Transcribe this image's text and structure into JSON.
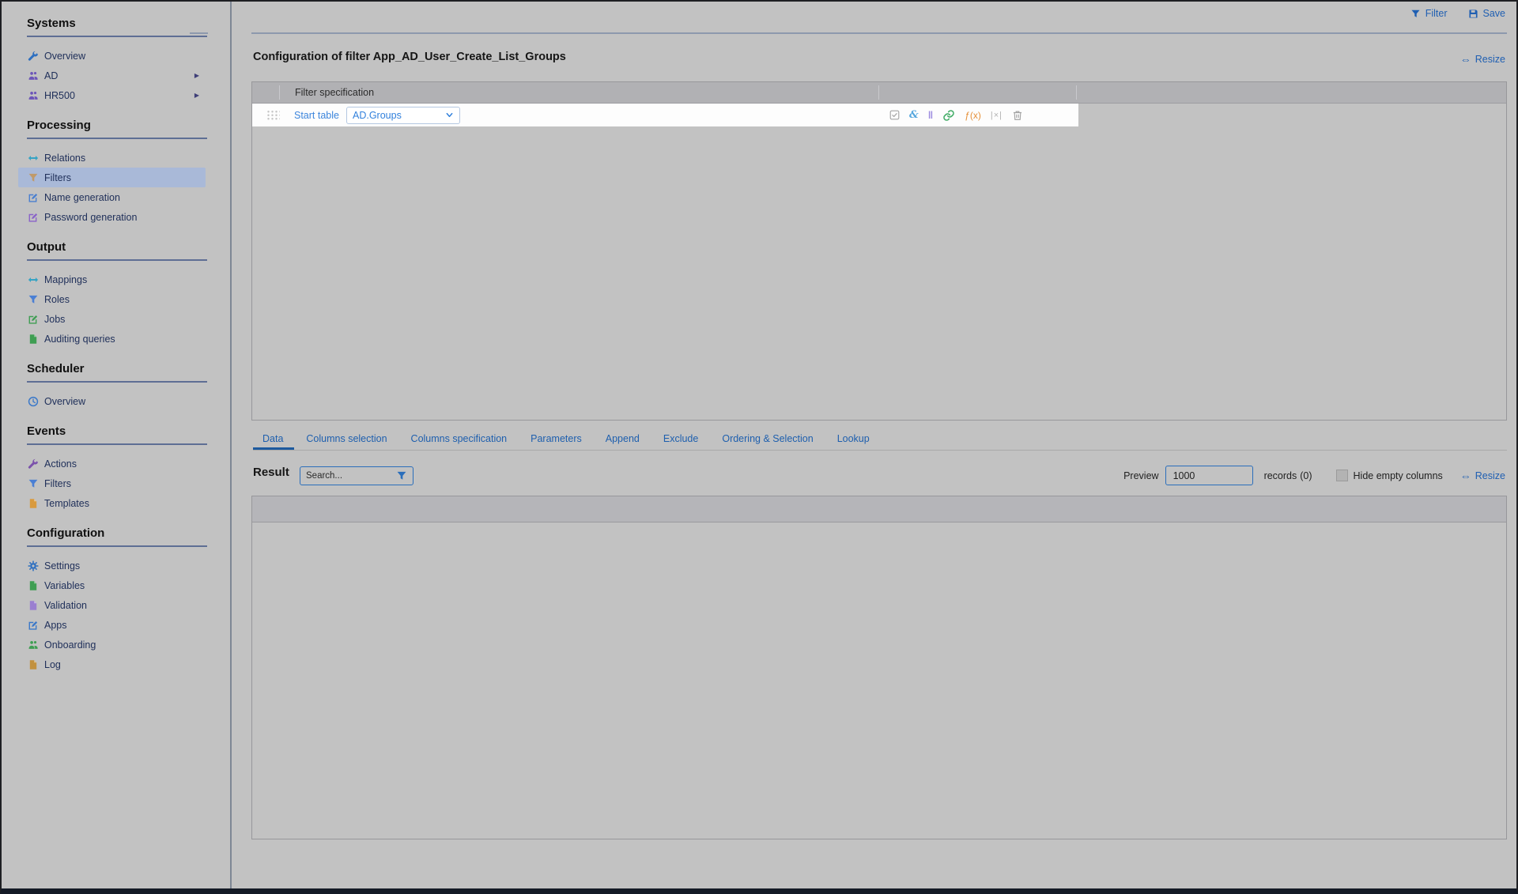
{
  "topbar": {
    "filter_label": "Filter",
    "save_label": "Save"
  },
  "page": {
    "title": "Configuration of filter App_AD_User_Create_List_Groups",
    "resize_label": "Resize"
  },
  "colors": {
    "accent_blue": "#1f5fb2",
    "link_blue": "#3c85dc",
    "selected_item_bg": "#a9b9d8",
    "page_bg": "#c2c2c2"
  },
  "filter_panel": {
    "header": "Filter specification",
    "start_table_label": "Start table",
    "start_table_value": "AD.Groups",
    "actions": [
      {
        "name": "validate-checkbox-icon",
        "glyph": "checksq",
        "color": "#a6a6a6"
      },
      {
        "name": "and-condition-icon",
        "glyph": "amp",
        "color": "#56a7de"
      },
      {
        "name": "or-condition-icon",
        "glyph": "pipes",
        "color": "#9d8ce0"
      },
      {
        "name": "link-table-icon",
        "glyph": "chain",
        "color": "#44ad68"
      },
      {
        "name": "function-icon",
        "glyph": "fx",
        "color": "#e6913a"
      },
      {
        "name": "exclude-null-icon",
        "glyph": "nullx",
        "color": "#b3b3b3"
      },
      {
        "name": "delete-row-icon",
        "glyph": "trash",
        "color": "#a3a3a3"
      }
    ]
  },
  "tabs": [
    {
      "label": "Data",
      "active": true
    },
    {
      "label": "Columns selection",
      "active": false
    },
    {
      "label": "Columns specification",
      "active": false
    },
    {
      "label": "Parameters",
      "active": false
    },
    {
      "label": "Append",
      "active": false
    },
    {
      "label": "Exclude",
      "active": false
    },
    {
      "label": "Ordering & Selection",
      "active": false
    },
    {
      "label": "Lookup",
      "active": false
    }
  ],
  "result": {
    "label": "Result",
    "search_placeholder": "Search...",
    "preview_label": "Preview",
    "preview_value": "1000",
    "records_label": "records",
    "records_count": "(0)",
    "hide_empty_label": "Hide empty columns",
    "hide_empty_checked": false,
    "resize_label": "Resize"
  },
  "sidebar": {
    "sections": [
      {
        "title": "Systems",
        "items": [
          {
            "label": "Overview",
            "icon": "wrench",
            "color": "#2d6fc0"
          },
          {
            "label": "AD",
            "icon": "users",
            "color": "#6c55b8",
            "arrow": true
          },
          {
            "label": "HR500",
            "icon": "users",
            "color": "#6c55b8",
            "arrow": true
          }
        ]
      },
      {
        "title": "Processing",
        "items": [
          {
            "label": "Relations",
            "icon": "arrows",
            "color": "#35a3c4"
          },
          {
            "label": "Filters",
            "icon": "funnel",
            "color": "#c09a6a",
            "selected": true
          },
          {
            "label": "Name generation",
            "icon": "editsq",
            "color": "#4a7fd0"
          },
          {
            "label": "Password generation",
            "icon": "editsq",
            "color": "#8a63c9"
          }
        ]
      },
      {
        "title": "Output",
        "items": [
          {
            "label": "Mappings",
            "icon": "arrows",
            "color": "#35a3c4"
          },
          {
            "label": "Roles",
            "icon": "funnel",
            "color": "#4a7fd4"
          },
          {
            "label": "Jobs",
            "icon": "editsq",
            "color": "#3f9e53"
          },
          {
            "label": "Auditing queries",
            "icon": "doc",
            "color": "#3f9e53"
          }
        ]
      },
      {
        "title": "Scheduler",
        "items": [
          {
            "label": "Overview",
            "icon": "clock",
            "color": "#3a78c9"
          }
        ]
      },
      {
        "title": "Events",
        "items": [
          {
            "label": "Actions",
            "icon": "wrench",
            "color": "#7b52ab"
          },
          {
            "label": "Filters",
            "icon": "funnel",
            "color": "#4a7fd4"
          },
          {
            "label": "Templates",
            "icon": "doc",
            "color": "#d99a3e"
          }
        ]
      },
      {
        "title": "Configuration",
        "items": [
          {
            "label": "Settings",
            "icon": "gear",
            "color": "#2d6fc0"
          },
          {
            "label": "Variables",
            "icon": "doc",
            "color": "#3f9e53"
          },
          {
            "label": "Validation",
            "icon": "doc",
            "color": "#9a7fd0"
          },
          {
            "label": "Apps",
            "icon": "editsq",
            "color": "#3a78c9"
          },
          {
            "label": "Onboarding",
            "icon": "users",
            "color": "#3f9e53"
          },
          {
            "label": "Log",
            "icon": "doc",
            "color": "#c2913f"
          }
        ]
      }
    ]
  }
}
